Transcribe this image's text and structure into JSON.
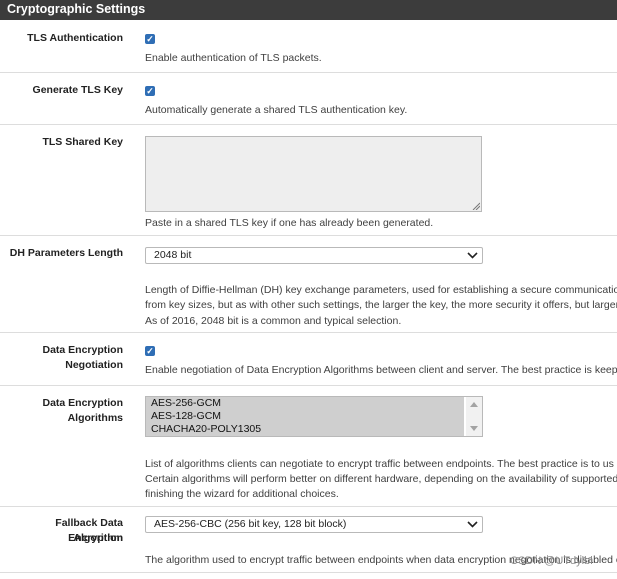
{
  "panel": {
    "title": "Cryptographic Settings"
  },
  "tls_auth": {
    "label": "TLS Authentication",
    "checked": true,
    "help": "Enable authentication of TLS packets."
  },
  "gen_tls_key": {
    "label": "Generate TLS Key",
    "checked": true,
    "help": "Automatically generate a shared TLS authentication key."
  },
  "tls_shared_key": {
    "label": "TLS Shared Key",
    "value": "",
    "help": "Paste in a shared TLS key if one has already been generated."
  },
  "dh_length": {
    "label": "DH Parameters Length",
    "selected": "2048 bit",
    "help_lines": [
      "Length of Diffie-Hellman (DH) key exchange parameters, used for establishing a secure communicatio",
      "from key sizes, but as with other such settings, the larger the key, the more security it offers, but larger",
      "As of 2016, 2048 bit is a common and typical selection."
    ]
  },
  "data_enc_negotiation": {
    "label_lines": [
      "Data Encryption",
      "Negotiation"
    ],
    "checked": true,
    "help": "Enable negotiation of Data Encryption Algorithms between client and server. The best practice is keep"
  },
  "data_enc_algorithms": {
    "label_lines": [
      "Data Encryption",
      "Algorithms"
    ],
    "options": [
      "AES-256-GCM",
      "AES-128-GCM",
      "CHACHA20-POLY1305"
    ],
    "help_lines": [
      "List of algorithms clients can negotiate to encrypt traffic between endpoints. The best practice is to us",
      "Certain algorithms will perform better on different hardware, depending on the availability of supported",
      "finishing the wizard for additional choices."
    ]
  },
  "fallback_algorithm": {
    "label_lines": [
      "Fallback Data Encryption",
      "Algorithm"
    ],
    "selected": "AES-256-CBC (256 bit key, 128 bit block)",
    "help": "The algorithm used to encrypt traffic between endpoints when data encryption negotiation is disabled o"
  },
  "watermark": "CSDN @UTdylbl",
  "colors": {
    "header_bg": "#3c3c3c",
    "checkbox": "#2f6eb5",
    "selected_option_bg": "#cfcfcf"
  }
}
